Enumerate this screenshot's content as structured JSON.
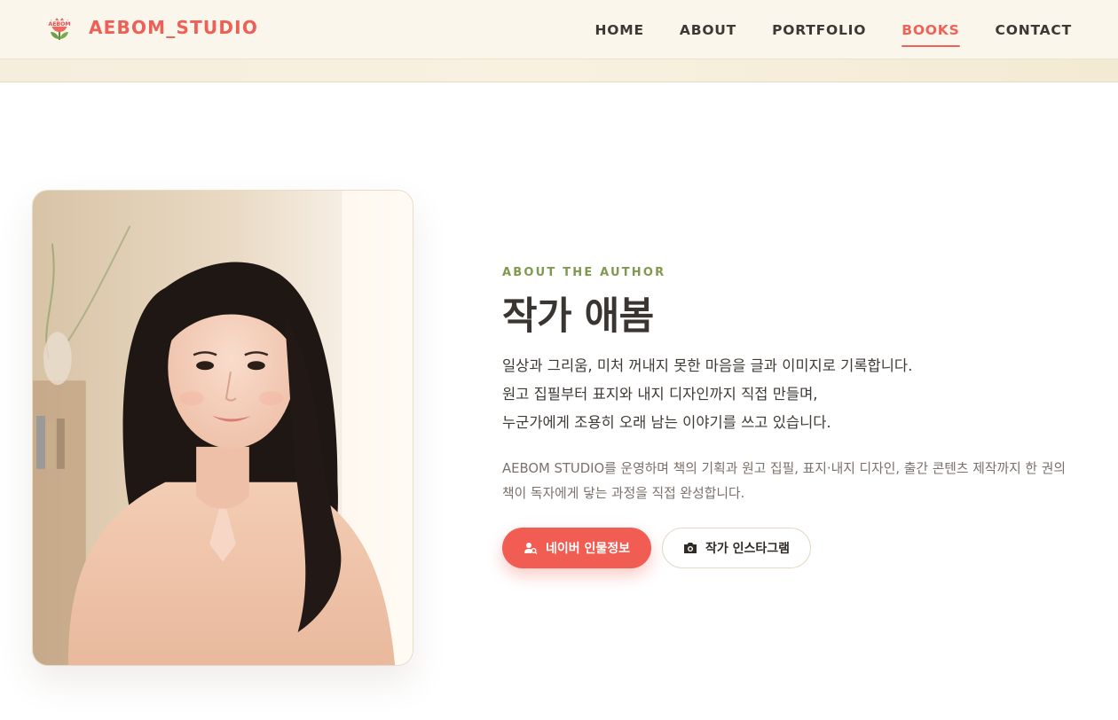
{
  "header": {
    "brand": "AEBOM_STUDIO",
    "logo_text": "AEBOM",
    "nav": [
      {
        "label": "HOME",
        "active": false
      },
      {
        "label": "ABOUT",
        "active": false
      },
      {
        "label": "PORTFOLIO",
        "active": false
      },
      {
        "label": "BOOKS",
        "active": true
      },
      {
        "label": "CONTACT",
        "active": false
      }
    ]
  },
  "author": {
    "eyebrow": "ABOUT THE AUTHOR",
    "title": "작가 애봄",
    "intro_lines": [
      "일상과 그리움, 미처 꺼내지 못한 마음을 글과 이미지로 기록합니다.",
      "원고 집필부터 표지와 내지 디자인까지 직접 만들며,",
      "누군가에게 조용히 오래 남는 이야기를 쓰고 있습니다."
    ],
    "description": "AEBOM STUDIO를 운영하며 책의 기획과 원고 집필, 표지·내지 디자인, 출간 콘텐츠 제작까지 한 권의 책이 독자에게 닿는 과정을 직접 완성합니다.",
    "buttons": {
      "primary": {
        "label": "네이버 인물정보",
        "icon": "person-search-icon"
      },
      "secondary": {
        "label": "작가 인스타그램",
        "icon": "camera-icon"
      }
    }
  },
  "colors": {
    "accent": "#f15d52",
    "brand": "#ee5f55",
    "eyebrow": "#7f9a4e",
    "header_bg": "#faf6ec"
  }
}
